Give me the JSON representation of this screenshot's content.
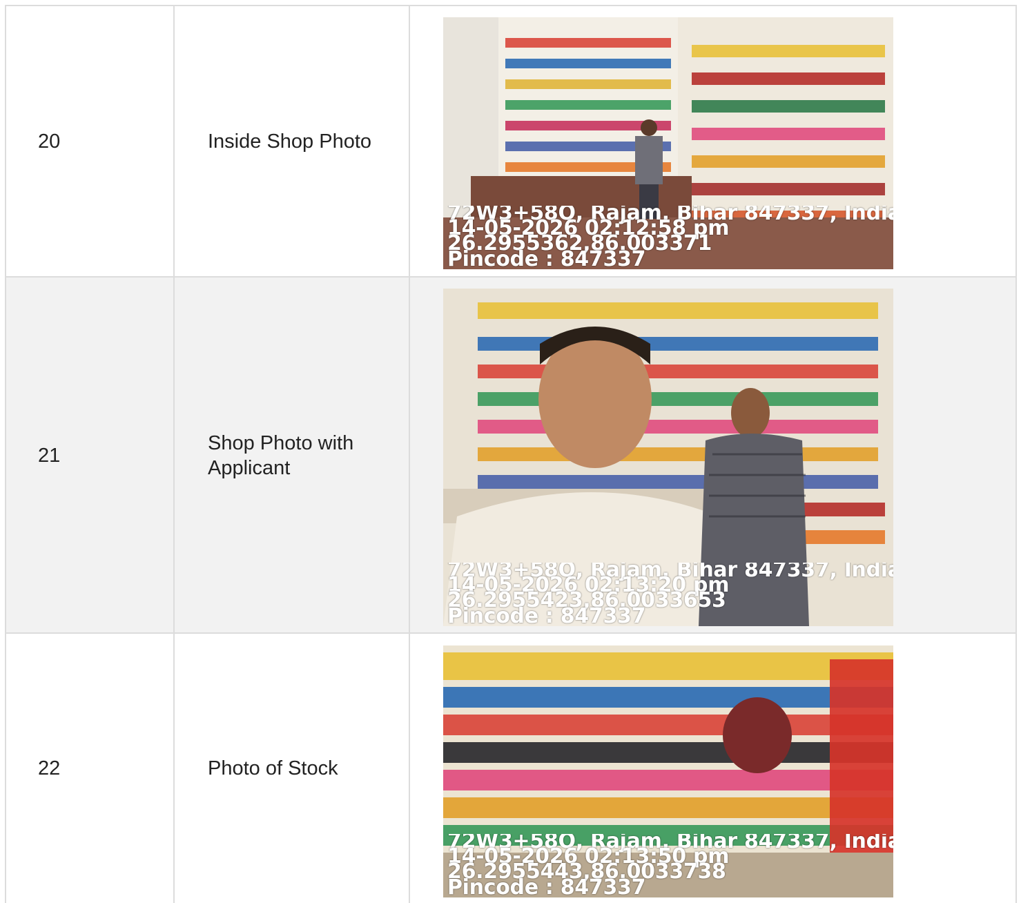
{
  "rows": [
    {
      "number": "20",
      "label": "Inside Shop Photo",
      "photo": {
        "subject": "shop interior with shelves of boxes and a man standing",
        "stamp": {
          "address": "72W3+58Q, Rajam, Bihar 847337, India ..",
          "datetime": "14-05-2026 02:12:58 pm",
          "coords": "26.2955362,86.003371",
          "pincode": "Pincode : 847337"
        }
      }
    },
    {
      "number": "21",
      "label": "Shop Photo with Applicant",
      "photo": {
        "subject": "selfie of a man in front of a shopkeeper among shelves",
        "stamp": {
          "address": "72W3+58Q, Rajam, Bihar 847337, India ..",
          "datetime": "14-05-2026 02:13:20 pm",
          "coords": "26.2955423,86.0033653",
          "pincode": "Pincode : 847337"
        }
      }
    },
    {
      "number": "22",
      "label": "Photo of Stock",
      "photo": {
        "subject": "shelves stocked with colorful boxes and packets",
        "stamp": {
          "address": "72W3+58Q, Rajam, Bihar 847337, India ..",
          "datetime": "14-05-2026 02:13:50 pm",
          "coords": "26.2955443,86.0033738",
          "pincode": "Pincode : 847337"
        }
      }
    }
  ]
}
